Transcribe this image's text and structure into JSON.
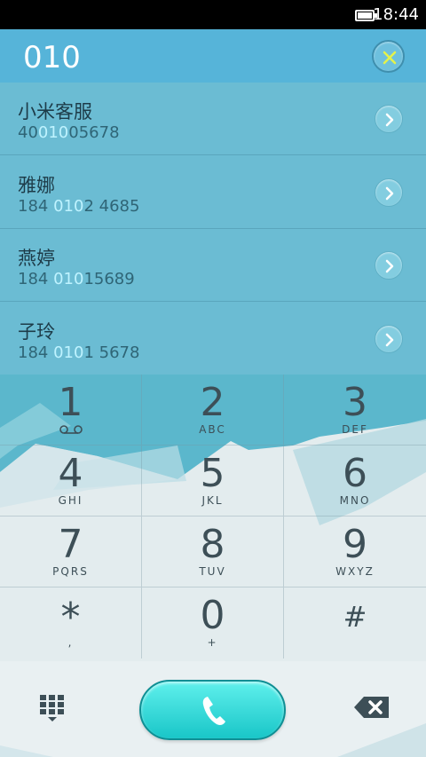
{
  "status_bar": {
    "time": "18:44",
    "battery_icon": "battery-icon"
  },
  "header": {
    "dialed_number": "010",
    "clear_icon": "clear-x-icon"
  },
  "contacts": [
    {
      "name": "小米客服",
      "phone_pre": "40",
      "phone_match": "010",
      "phone_post": "05678"
    },
    {
      "name": "雅娜",
      "phone_pre": "184 ",
      "phone_match": "010",
      "phone_post": "2 4685"
    },
    {
      "name": "燕婷",
      "phone_pre": "184 ",
      "phone_match": "010",
      "phone_post": "15689"
    },
    {
      "name": "子玲",
      "phone_pre": "184 ",
      "phone_match": "010",
      "phone_post": "1 5678"
    }
  ],
  "keypad": [
    {
      "digit": "1",
      "letters": ""
    },
    {
      "digit": "2",
      "letters": "ABC"
    },
    {
      "digit": "3",
      "letters": "DEF"
    },
    {
      "digit": "4",
      "letters": "GHI"
    },
    {
      "digit": "5",
      "letters": "JKL"
    },
    {
      "digit": "6",
      "letters": "MNO"
    },
    {
      "digit": "7",
      "letters": "PQRS"
    },
    {
      "digit": "8",
      "letters": "TUV"
    },
    {
      "digit": "9",
      "letters": "WXYZ"
    },
    {
      "digit": "*",
      "letters": ","
    },
    {
      "digit": "0",
      "letters": "+"
    },
    {
      "digit": "#",
      "letters": ""
    }
  ],
  "colors": {
    "header": "#56b4d9",
    "list": "#6bbcd3",
    "highlight": "#bff3ff",
    "call": "#19c6c8"
  }
}
